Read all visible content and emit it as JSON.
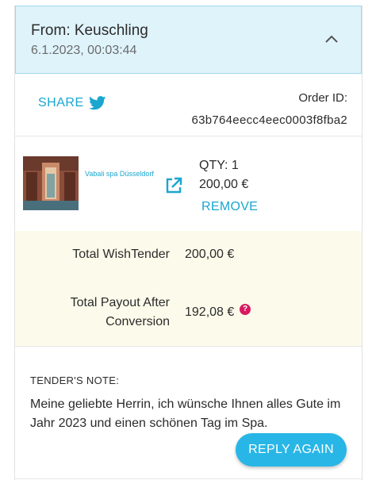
{
  "header": {
    "from": "From: Keuschling",
    "date": "6.1.2023, 00:03:44",
    "collapse_icon": "chevron-up-icon"
  },
  "share": {
    "label": "SHARE",
    "icon": "twitter-icon",
    "order_label": "Order ID:",
    "order_id": "63b764eecc4eec0003f8fba2"
  },
  "item": {
    "name": "Vabali spa Düsseldorf",
    "qty": "QTY: 1",
    "price": "200,00 €",
    "remove_label": "REMOVE",
    "link_icon": "external-link-icon"
  },
  "totals": {
    "wishtender_label": "Total WishTender",
    "wishtender_value": "200,00 €",
    "payout_label_line1": "Total Payout After",
    "payout_label_line2": "Conversion",
    "payout_value": "192,08 €",
    "help_icon": "question-mark-icon"
  },
  "note": {
    "label": "TENDER'S NOTE:",
    "text": "Meine geliebte Herrin, ich wünsche Ihnen alles Gute im Jahr 2023 und einen schönen Tag im Spa.",
    "reply_label": "REPLY AGAIN"
  },
  "colors": {
    "accent": "#1aa6cf",
    "header_bg": "#dff3fb",
    "totals_bg": "#fcfbeb",
    "reply_bg": "#28b6e6",
    "help_badge": "#d81b60"
  }
}
